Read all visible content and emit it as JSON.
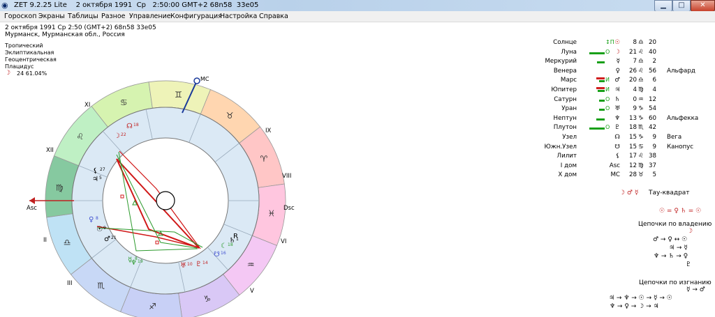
{
  "window": {
    "title": "ZET 9.2.25 Lite    2 октября 1991  Ср   2:50:00 GMT+2 68n58  33e05",
    "minimize": "▁",
    "maximize": "□",
    "close": "✕"
  },
  "menu": [
    "Гороскоп",
    "Экраны",
    "Таблицы",
    "Разное",
    "Управление",
    "Конфигурация",
    "Настройка",
    "Справка"
  ],
  "chart_info": {
    "datetime": "2 октября 1991  Ср   2:50 (GMT+2)  68n58  33e05",
    "place": "Мурманск, Мурманская обл., Россия",
    "zodiac": "Тропический",
    "coords": "Эклиптикальная",
    "center": "Геоцентрическая",
    "houses": "Плацидус",
    "moon_glyph": "☽",
    "moon_phase": "24  61.04%"
  },
  "chart_labels": {
    "mc": "MC",
    "asc": "Asc",
    "dsc": "Dsc",
    "houses": [
      "II",
      "III",
      "V",
      "VI",
      "VIII",
      "IX",
      "XI",
      "XII"
    ],
    "signs": [
      "♉",
      "♈",
      "♓",
      "♒",
      "♑",
      "♐",
      "♏",
      "♎",
      "♍",
      "♌",
      "♋",
      "♊"
    ]
  },
  "wheel_planets": [
    {
      "glyph": "☊",
      "deg": "18"
    },
    {
      "glyph": "☽",
      "deg": "22"
    },
    {
      "glyph": "♃",
      "deg": "5"
    },
    {
      "glyph": "⚸",
      "deg": "27"
    },
    {
      "glyph": "♀",
      "deg": "8"
    },
    {
      "glyph": "☉",
      "deg": "9"
    },
    {
      "glyph": "♂",
      "deg": "21"
    },
    {
      "glyph": "☿",
      "deg": "8"
    },
    {
      "glyph": "♆",
      "deg": "19"
    },
    {
      "glyph": "♅",
      "deg": "10"
    },
    {
      "glyph": "♇",
      "deg": "14"
    },
    {
      "glyph": "☋",
      "deg": "16"
    },
    {
      "glyph": "☾",
      "deg": "18"
    },
    {
      "glyph": "♄",
      "deg": "1"
    },
    {
      "glyph": "R",
      "deg": ""
    }
  ],
  "planets_table": [
    {
      "name": "Солнце",
      "icons": "↕П",
      "glyph": "☉",
      "deg": "8",
      "sign": "♎",
      "min": "20",
      "star": ""
    },
    {
      "name": "Луна",
      "icons": "О",
      "glyph": "☽",
      "deg": "21",
      "sign": "♌",
      "min": "40",
      "star": ""
    },
    {
      "name": "Меркурий",
      "icons": "",
      "glyph": "☿",
      "deg": "7",
      "sign": "♎",
      "min": "2",
      "star": ""
    },
    {
      "name": "Венера",
      "icons": "",
      "glyph": "♀",
      "deg": "26",
      "sign": "♌",
      "min": "56",
      "star": "Альфард"
    },
    {
      "name": "Марс",
      "icons": "И",
      "glyph": "♂",
      "deg": "20",
      "sign": "♎",
      "min": "6",
      "star": ""
    },
    {
      "name": "Юпитер",
      "icons": "И",
      "glyph": "♃",
      "deg": "4",
      "sign": "♍",
      "min": "4",
      "star": ""
    },
    {
      "name": "Сатурн",
      "icons": "О",
      "glyph": "♄",
      "deg": "0",
      "sign": "♒",
      "min": "12",
      "star": ""
    },
    {
      "name": "Уран",
      "icons": "О",
      "glyph": "♅",
      "deg": "9",
      "sign": "♑",
      "min": "54",
      "star": ""
    },
    {
      "name": "Нептун",
      "icons": "",
      "glyph": "♆",
      "deg": "13",
      "sign": "♑",
      "min": "60",
      "star": "Альфекка"
    },
    {
      "name": "Плутон",
      "icons": "О",
      "glyph": "♇",
      "deg": "18",
      "sign": "♏",
      "min": "42",
      "star": ""
    },
    {
      "name": "Узел",
      "icons": "",
      "glyph": "☊",
      "deg": "15",
      "sign": "♑",
      "min": "9",
      "star": "Вега"
    },
    {
      "name": "Южн.Узел",
      "icons": "",
      "glyph": "☋",
      "deg": "15",
      "sign": "♋",
      "min": "9",
      "star": "Канопус"
    },
    {
      "name": "Лилит",
      "icons": "",
      "glyph": "⚸",
      "deg": "17",
      "sign": "♌",
      "min": "38",
      "star": ""
    },
    {
      "name": "I дом",
      "icons": "",
      "glyph": "Asc",
      "deg": "12",
      "sign": "♍",
      "min": "37",
      "star": ""
    },
    {
      "name": "X дом",
      "icons": "",
      "glyph": "MC",
      "deg": "28",
      "sign": "♉",
      "min": "5",
      "star": ""
    }
  ],
  "aspects_right": {
    "tau_glyphs": "☽ ♂ ☿",
    "tau_label": "Тау-квадрат",
    "equation": "☉ = ♀ ♄ = ☉",
    "chains_owner_title": "Цепочки по владению",
    "chains_owner": [
      "☽",
      "♂ → ♀ ↔ ☉",
      "♃ → ☿",
      "♆ → ♄ → ♀",
      "♇"
    ],
    "chains_exile_title": "Цепочки по изгнанию",
    "chains_exile": [
      "☿ → ♂",
      "♃ → ♆ → ☉ → ☿ → ☉",
      "♆ → ♀ → ☽ → ♃"
    ]
  },
  "colors": {
    "titlebar": "#c8dcf0",
    "menubar": "#f0f0f0",
    "aspect_red": "#d01818",
    "aspect_green": "#2c9a2c",
    "dignity_green": "#19a019",
    "dignity_red": "#d02020"
  }
}
